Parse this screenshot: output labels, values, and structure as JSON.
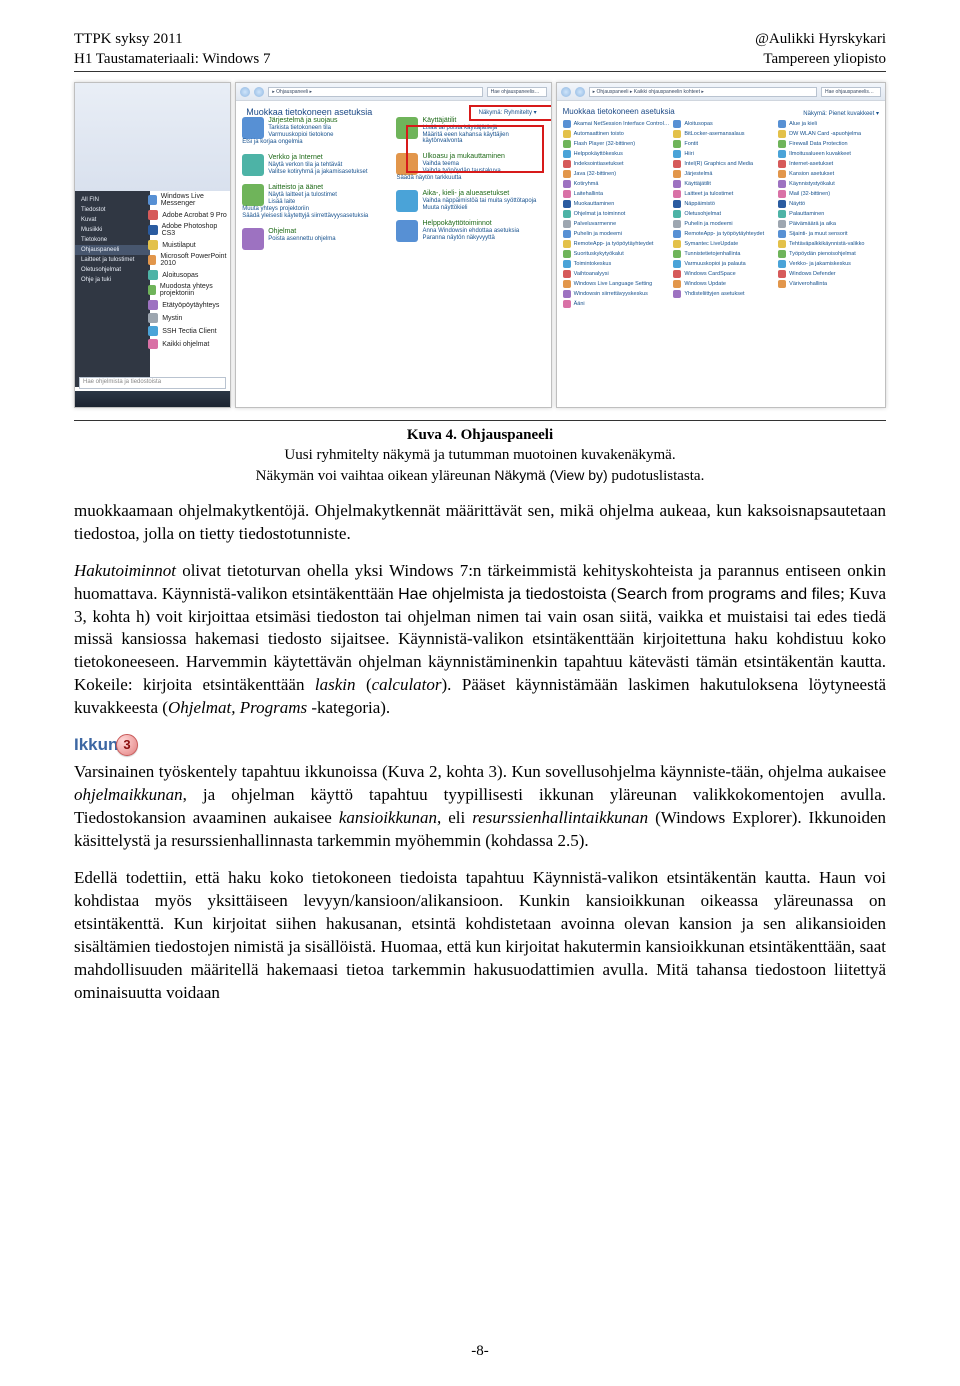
{
  "header": {
    "left1": "TTPK syksy 2011",
    "left2": "H1 Taustamateriaali: Windows 7",
    "right1": "@Aulikki Hyrskykari",
    "right2": "Tampereen yliopisto"
  },
  "figure": {
    "left_win": {
      "taskbar_items": [
        "Windows Live Messenger",
        "Adobe Acrobat 9 Pro",
        "Adobe Photoshop CS3",
        "Muistilaput",
        "Microsoft PowerPoint 2010",
        "Aloitusopas",
        "Muodosta yhteys projektoriin",
        "Etätyöpöytäyhteys",
        "Mystin",
        "SSH Tectia Client",
        "Kaikki ohjelmat"
      ],
      "side_items": [
        "All FIN",
        "Tiedostot",
        "Kuvat",
        "Musiikki",
        "Tietokone",
        "Ohjauspaneeli",
        "Laitteet ja tulostimet",
        "Oletusohjelmat",
        "Ohje ja tuki"
      ],
      "search_placeholder": "Hae ohjelmista ja tiedostoista"
    },
    "mid_win": {
      "addr": "▸ Ohjauspaneeli ▸",
      "search": "Hae ohjauspaneelis…",
      "view_label": "Näkymä: Ryhmitelty ▾",
      "heading": "Muokkaa tietokoneen asetuksia",
      "groups_left": [
        {
          "title": "Järjestelmä ja suojaus",
          "links": [
            "Tarkista tietokoneen tila",
            "Varmuuskopioi tietokone",
            "Etsi ja korjaa ongelmia"
          ]
        },
        {
          "title": "Verkko ja Internet",
          "links": [
            "Näytä verkon tila ja tehtävät",
            "Valitse kotiryhmä ja jakamisasetukset"
          ]
        },
        {
          "title": "Laitteisto ja äänet",
          "links": [
            "Näytä laitteet ja tulostimet",
            "Lisää laite",
            "Muuta yhteys projektoriin",
            "Säädä yleisesti käytettyjä siirrettävyysasetuksia"
          ]
        },
        {
          "title": "Ohjelmat",
          "links": [
            "Poista asennettu ohjelma"
          ]
        }
      ],
      "groups_right": [
        {
          "title": "Käyttäjätilit",
          "links": [
            "Lisää tai poista käyttäjätilejä",
            "Määritä eeen kahansa käyttäjien käytönvalvonta"
          ]
        },
        {
          "title": "Ulkoasu ja mukauttaminen",
          "links": [
            "Vaihda teema",
            "Vaihda työpöydän taustakuva",
            "Säädä näytön tarkkuutta"
          ]
        },
        {
          "title": "Aika-, kieli- ja alueasetukset",
          "links": [
            "Vaihda näppäimistöä tai muita syöttötapoja",
            "Muuta näyttökieli"
          ]
        },
        {
          "title": "Helppokäyttötoiminnot",
          "links": [
            "Anna Windowsin ehdottaa asetuksia",
            "Paranna näytön näkyvyyttä"
          ]
        }
      ]
    },
    "right_win": {
      "addr": "▸ Ohjauspaneeli ▸ Kaikki ohjauspaneelin kohteet ▸",
      "search": "Hae ohjauspaneelis…",
      "view_label": "Näkymä: Pienet kuvakkeet ▾",
      "heading": "Muokkaa tietokoneen asetuksia",
      "col1": [
        "Akamai NetSession Interface Control…",
        "Automaattinen toisto",
        "Flash Player (32-bittinen)",
        "Helppokäyttökeskus",
        "Indeksointiasetukset",
        "Java (32-bittinen)",
        "Kotiryhmä",
        "Laitehallinta",
        "Muokauttaminen",
        "Ohjelmat ja toiminnot",
        "Palveluvarmenne",
        "Puhelin ja modeemi",
        "RemoteApp- ja työpöytäyhteydet",
        "Suorituskykytyökalut",
        "Toimintokeskus",
        "Vaihtoanalyysi",
        "Windows Live Language Setting",
        "Windowsin siirrettävyyskeskus",
        "Ääni"
      ],
      "col2": [
        "Aloitusopas",
        "BitLocker-asemansalaus",
        "Fontit",
        "Hiiri",
        "Intel(R) Graphics and Media",
        "Järjestelmä",
        "Käyttäjätilit",
        "Laitteet ja tulostimet",
        "Näppäimistö",
        "Oletusohjelmat",
        "Puhelin ja modeemi",
        "RemoteApp- ja työpöytäyhteydet",
        "Symantec LiveUpdate",
        "Tunnistetietojenhallinta",
        "Varmuuskopioi ja palauta",
        "Windows CardSpace",
        "Windows Update",
        "Yhdisteliittyjen asetukset"
      ],
      "col3": [
        "Alue ja kieli",
        "DW WLAN Card -apuohjelma",
        "Firewall Data Protection",
        "Ilmoitusalueen kuvakkeet",
        "Internet-asetukset",
        "Kansion asetukset",
        "Käynnistystyökalut",
        "Mail (32-bittinen)",
        "Näyttö",
        "Palauttaminen",
        "Päivämäärä ja aika",
        "Sijainti- ja muut sensorit",
        "Tehtäväpalkkikäynnistä-valikko",
        "Työpöydän pienoisohjelmat",
        "Verkko- ja jakamiskeskus",
        "Windows Defender",
        "Väriverohallinta"
      ]
    },
    "caption": {
      "title": "Kuva 4. Ohjauspaneeli",
      "line1": "Uusi ryhmitelty näkymä ja tutumman muotoinen kuvakenäkymä.",
      "line2a": "Näkymän voi vaihtaa oikean yläreunan ",
      "line2b_view": "Näkymä (View by)",
      "line2c": " pudotuslistasta."
    }
  },
  "body": {
    "p1": "muokkaamaan ohjelmakytkentöjä. Ohjelmakytkennät määrittävät sen, mikä ohjelma aukeaa, kun kaksoisnapsautetaan tiedostoa, jolla on tietty tiedostotunniste.",
    "p2a": "Hakutoiminnot",
    "p2b": " olivat tietoturvan ohella yksi Windows 7:n tärkeimmistä kehityskohteista ja parannus entiseen onkin huomattava. Käynnistä-valikon etsintäkenttään ",
    "p2c_sc": "Hae ohjelmista ja tiedostoista",
    "p2d": " (",
    "p2e_sc": "Search from programs and files",
    "p2f": "; Kuva 3, kohta h) voit kirjoittaa etsimäsi tiedoston tai ohjelman nimen tai vain osan siitä, vaikka et muistaisi tai edes tiedä missä kansiossa hakemasi tiedosto sijaitsee. Käynnistä-valikon etsintäkenttään kirjoitettuna haku kohdistuu koko tietokoneeseen. Harvemmin käytettävän ohjelman käynnistäminenkin tapahtuu kätevästi tämän etsintäkentän kautta. Kokeile: kirjoita etsintäkenttään ",
    "p2g": "laskin",
    "p2h": " (",
    "p2i": "calculator",
    "p2j": "). Pääset käynnistämään laskimen hakutuloksena löytyneestä kuvakkeesta (",
    "p2k": "Ohjelmat, Programs -",
    "p2l": "kategoria).",
    "badge": "3",
    "h_ikkunat": "Ikkunat",
    "p3a": "Varsinainen työskentely tapahtuu ikkunoissa (Kuva 2, kohta 3). Kun sovellusohjelma käynniste-tään, ohjelma aukaisee ",
    "p3b": "ohjelmaikkunan",
    "p3c": ", ja ohjelman käyttö tapahtuu tyypillisesti ikkunan yläreunan valikkokomentojen avulla. Tiedostokansion avaaminen aukaisee ",
    "p3d": "kansioikkunan",
    "p3e": ", eli ",
    "p3f": "resurssienhallintaikkunan",
    "p3g": " (Windows Explorer). Ikkunoiden käsittelystä ja resurssienhallinnasta tarkemmin myöhemmin (kohdassa 2.5).",
    "p4": "Edellä todettiin, että haku koko tietokoneen tiedoista tapahtuu Käynnistä-valikon etsintäkentän kautta. Haun voi kohdistaa myös yksittäiseen levyyn/kansioon/alikansioon. Kunkin kansioikkunan oikeassa yläreunassa on etsintäkenttä. Kun kirjoitat siihen hakusanan, etsintä kohdistetaan avoinna olevan kansion ja sen alikansioiden sisältämien tiedostojen nimistä ja sisällöistä. Huomaa, että kun kirjoitat hakutermin kansioikkunan etsintäkenttään, saat mahdollisuuden määritellä hakemaasi tietoa tarkemmin hakusuodattimien avulla. Mitä tahansa tiedostoon liitettyä ominaisuutta voidaan"
  },
  "footer": {
    "page": "-8-"
  }
}
